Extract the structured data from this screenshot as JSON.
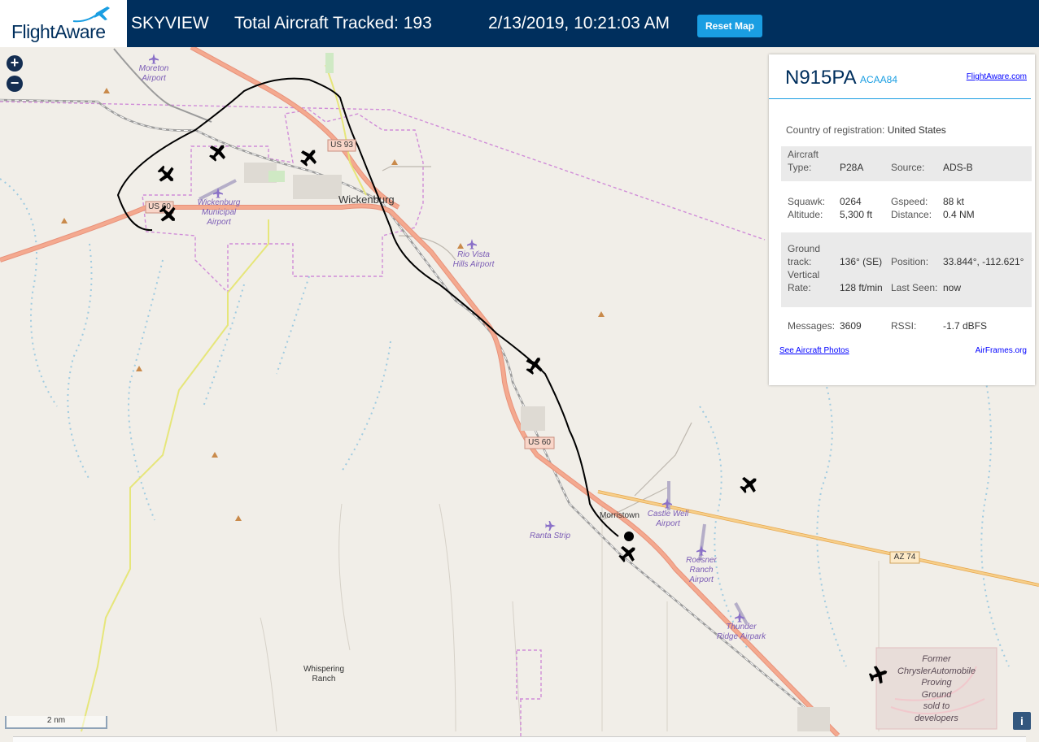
{
  "header": {
    "logo_text": "FlightAware",
    "skyview": "SKYVIEW",
    "total_aircraft": "Total Aircraft Tracked: 193",
    "timestamp": "2/13/2019, 10:21:03 AM",
    "reset_label": "Reset Map"
  },
  "map_controls": {
    "zoom_in": "+",
    "zoom_out": "−",
    "scale": "2 nm",
    "info": "i"
  },
  "map_labels": {
    "moreton": "Moreton",
    "moreton2": "Airport",
    "wickenburg": "Wickenburg",
    "wick_muni1": "Wickenburg",
    "wick_muni2": "Municipal",
    "wick_muni3": "Airport",
    "rio_vista1": "Rio Vista",
    "rio_vista2": "Hills Airport",
    "morristown": "Morristown",
    "castle_well1": "Castle Well",
    "castle_well2": "Airport",
    "ranta": "Ranta Strip",
    "roesner1": "Roesner",
    "roesner2": "Ranch",
    "roesner3": "Airport",
    "thunder1": "Thunder",
    "thunder2": "Ridge Airpark",
    "whispering1": "Whispering",
    "whispering2": "Ranch",
    "chrysler1": "Former",
    "chrysler2": "ChryslerAutomobile",
    "chrysler3": "Proving",
    "chrysler4": "Ground",
    "chrysler5": "sold to",
    "chrysler6": "developers",
    "us93": "US 93",
    "us60a": "US 60",
    "us60b": "US 60",
    "az74": "AZ 74"
  },
  "panel": {
    "registration": "N915PA",
    "hex": "ACAA84",
    "fa_link": "FlightAware.com",
    "country_label": "Country of registration:",
    "country_value": "United States",
    "aircraft_type_label1": "Aircraft",
    "aircraft_type_label2": "Type:",
    "aircraft_type": "P28A",
    "source_label": "Source:",
    "source": "ADS-B",
    "squawk_label": "Squawk:",
    "squawk": "0264",
    "gspeed_label": "Gspeed:",
    "gspeed": "88 kt",
    "altitude_label": "Altitude:",
    "altitude": "5,300 ft",
    "distance_label": "Distance:",
    "distance": "0.4 NM",
    "ground_label1": "Ground",
    "ground_label2": "track:",
    "ground_track": "136° (SE)",
    "position_label": "Position:",
    "position": "33.844°, -112.621°",
    "vr_label1": "Vertical",
    "vr_label2": "Rate:",
    "vertical_rate": "128 ft/min",
    "last_seen_label": "Last Seen:",
    "last_seen": "now",
    "messages_label": "Messages:",
    "messages": "3609",
    "rssi_label": "RSSI:",
    "rssi": "-1.7 dBFS",
    "photos_link": "See Aircraft Photos",
    "airframes_link": "AirFrames.org"
  },
  "colors": {
    "header_bg": "#002f5d",
    "accent": "#1a9ee2",
    "map_bg": "#f1eee8",
    "road": "#f09f83",
    "state_road": "#f5c779"
  }
}
